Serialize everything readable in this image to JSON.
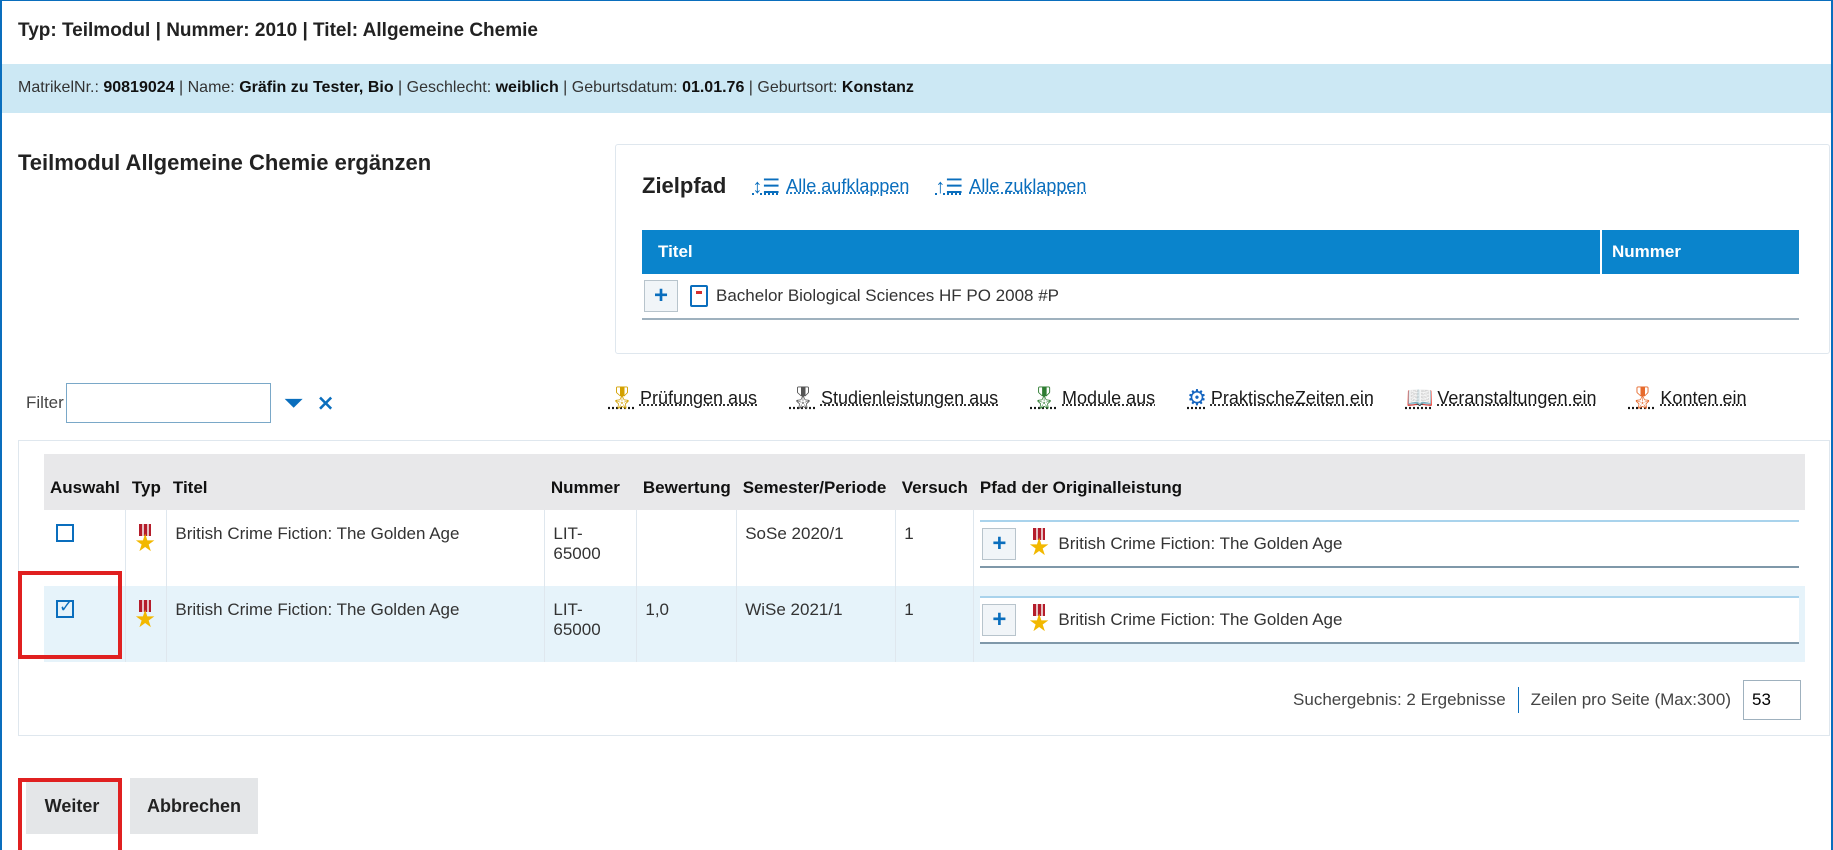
{
  "header": {
    "typ_label": "Typ:",
    "typ_value": "Teilmodul",
    "nummer_label": "Nummer:",
    "nummer_value": "2010",
    "titel_label": "Titel:",
    "titel_value": "Allgemeine Chemie",
    "separator": "|"
  },
  "student": {
    "matrikel_label": "MatrikelNr.:",
    "matrikel_value": "90819024",
    "name_label": "Name:",
    "name_value": "Gräfin zu Tester, Bio",
    "geschlecht_label": "Geschlecht:",
    "geschlecht_value": "weiblich",
    "geburtsdatum_label": "Geburtsdatum:",
    "geburtsdatum_value": "01.01.76",
    "geburtsort_label": "Geburtsort:",
    "geburtsort_value": "Konstanz",
    "separator": "|"
  },
  "section_title": "Teilmodul Allgemeine Chemie ergänzen",
  "zielpfad": {
    "title": "Zielpfad",
    "expand_all": "Alle aufklappen",
    "collapse_all": "Alle zuklappen",
    "expand_icon": "↕☰",
    "collapse_icon": "↑☰",
    "columns": [
      "Titel",
      "Nummer"
    ],
    "row": {
      "title": "Bachelor Biological Sciences HF PO 2008 #P",
      "nummer": "",
      "expand": "+"
    }
  },
  "filter": {
    "label": "Filter",
    "value": "",
    "placeholder": ""
  },
  "actions": [
    {
      "label": "Prüfungen aus",
      "icon": "ribbon-icon"
    },
    {
      "label": "Studienleistungen aus",
      "icon": "ribbon-icon"
    },
    {
      "label": "Module aus",
      "icon": "ribbon-icon"
    },
    {
      "label": "PraktischeZeiten ein",
      "icon": "gear-icon"
    },
    {
      "label": "Veranstaltungen ein",
      "icon": "book-icon"
    },
    {
      "label": "Konten ein",
      "icon": "ribbon-icon"
    }
  ],
  "table": {
    "columns": [
      "Auswahl",
      "Typ",
      "Titel",
      "Nummer",
      "Bewertung",
      "Semester/Periode",
      "Versuch",
      "Pfad der Originalleistung"
    ],
    "rows": [
      {
        "selected": false,
        "title": "British Crime Fiction: The Golden Age",
        "nummer": "LIT-65000",
        "bewertung": "",
        "semester": "SoSe 2020/1",
        "versuch": "1",
        "pfad": "British Crime Fiction: The Golden Age"
      },
      {
        "selected": true,
        "title": "British Crime Fiction: The Golden Age",
        "nummer": "LIT-65000",
        "bewertung": "1,0",
        "semester": "WiSe 2021/1",
        "versuch": "1",
        "pfad": "British Crime Fiction: The Golden Age"
      }
    ],
    "result_text": "Suchergebnis: 2 Ergebnisse",
    "rows_per_page_label": "Zeilen pro Seite (Max:300)",
    "rows_per_page_value": "53",
    "expand": "+"
  },
  "buttons": {
    "weiter": "Weiter",
    "abbrechen": "Abbrechen"
  },
  "colors": {
    "accent": "#0a84cc",
    "highlight": "#e02020",
    "infobar": "#cce8f4"
  }
}
